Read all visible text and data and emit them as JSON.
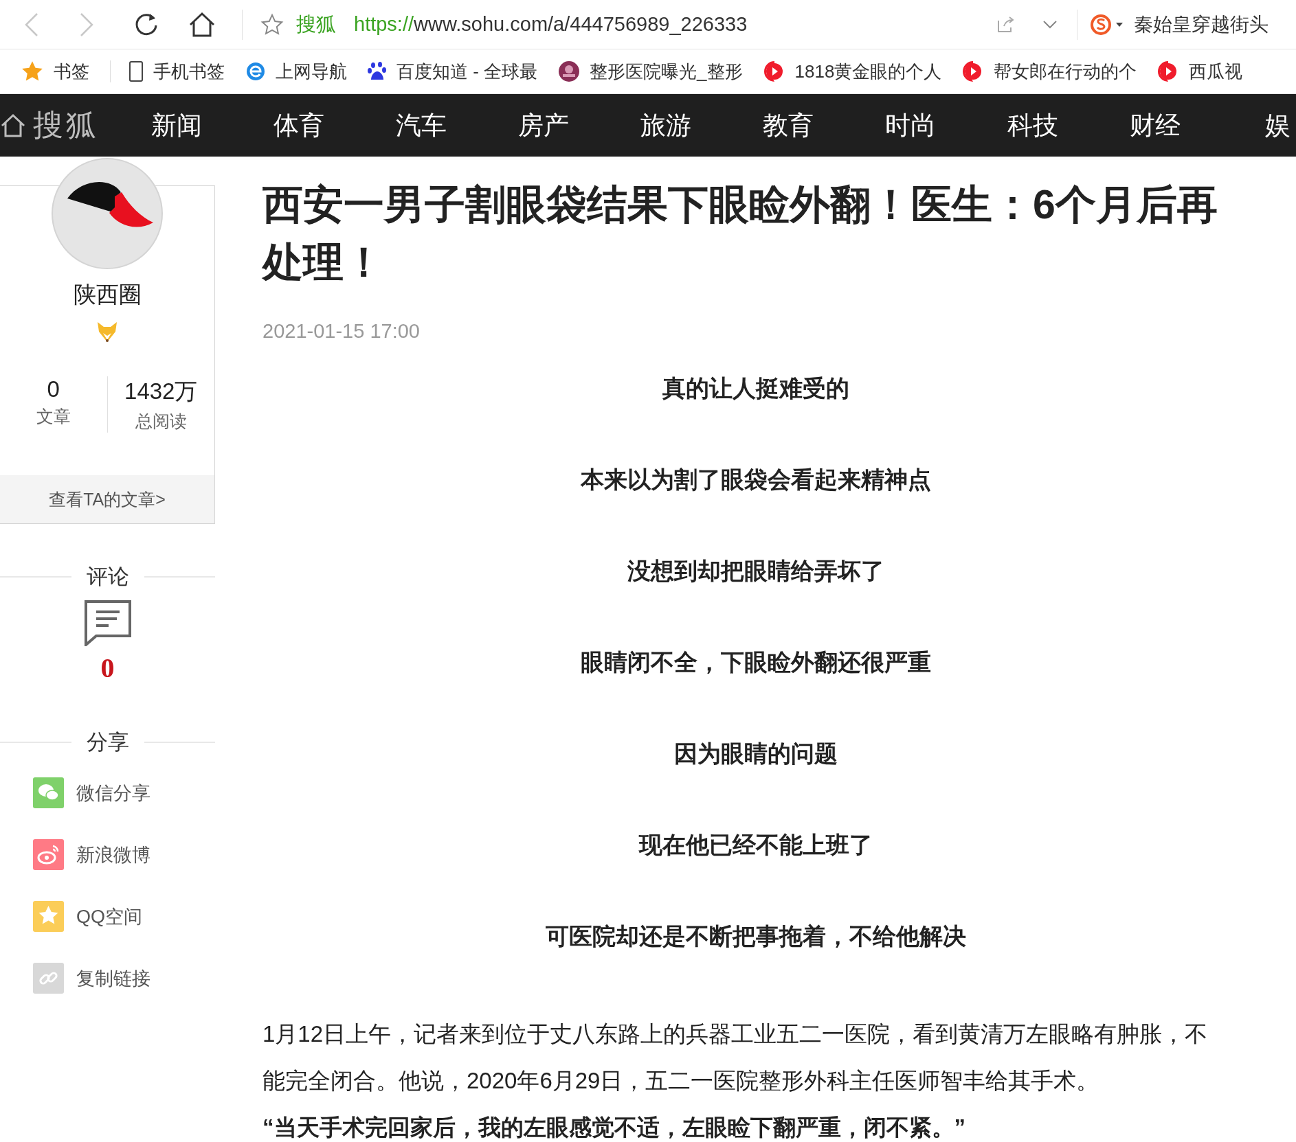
{
  "address_bar": {
    "site_name": "搜狐",
    "url_scheme": "https://",
    "url_rest": "www.sohu.com/a/444756989_226333"
  },
  "search_box": {
    "value": "秦始皇穿越街头"
  },
  "bookmarks": [
    {
      "label": "书签",
      "kind": "star"
    },
    {
      "label": "手机书签",
      "kind": "phone"
    },
    {
      "label": "上网导航",
      "kind": "browser"
    },
    {
      "label": "百度知道 - 全球最",
      "kind": "paw"
    },
    {
      "label": "整形医院曝光_整形",
      "kind": "badge"
    },
    {
      "label": "1818黄金眼的个人",
      "kind": "video"
    },
    {
      "label": "帮女郎在行动的个",
      "kind": "video"
    },
    {
      "label": "西瓜视",
      "kind": "video"
    }
  ],
  "site_nav": {
    "logo": "搜狐",
    "items": [
      "新闻",
      "体育",
      "汽车",
      "房产",
      "旅游",
      "教育",
      "时尚",
      "科技",
      "财经",
      "娱"
    ]
  },
  "author": {
    "name": "陕西圈",
    "stats": [
      {
        "value": "0",
        "label": "文章"
      },
      {
        "value": "1432万",
        "label": "总阅读"
      }
    ],
    "link": "查看TA的文章>"
  },
  "comments": {
    "title": "评论",
    "count": "0"
  },
  "share": {
    "title": "分享",
    "items": [
      {
        "label": "微信分享",
        "kind": "wechat",
        "color": "#7fd16a"
      },
      {
        "label": "新浪微博",
        "kind": "weibo",
        "color": "#ff7a85"
      },
      {
        "label": "QQ空间",
        "kind": "qzone",
        "color": "#fbcd58"
      },
      {
        "label": "复制链接",
        "kind": "link",
        "color": "#d8d8d8"
      }
    ]
  },
  "article": {
    "title": "西安一男子割眼袋结果下眼睑外翻！医生：6个月后再处理！",
    "date": "2021-01-15 17:00",
    "blocks": [
      {
        "kind": "lead",
        "text": "真的让人挺难受的"
      },
      {
        "kind": "lead",
        "text": "本来以为割了眼袋会看起来精神点"
      },
      {
        "kind": "lead",
        "text": "没想到却把眼睛给弄坏了"
      },
      {
        "kind": "lead",
        "text": "眼睛闭不全，下眼睑外翻还很严重"
      },
      {
        "kind": "lead",
        "text": "因为眼睛的问题"
      },
      {
        "kind": "lead",
        "text": "现在他已经不能上班了"
      },
      {
        "kind": "lead",
        "text": "可医院却还是不断把事拖着，不给他解决"
      },
      {
        "kind": "para",
        "text": "1月12日上午，记者来到位于丈八东路上的兵器工业五二一医院，看到黄清万左眼略有肿胀，不能完全闭合。他说，2020年6月29日，五二一医院整形外科主任医师智丰给其手术。"
      },
      {
        "kind": "quote",
        "text": "“当天手术完回家后，我的左眼感觉不适，左眼睑下翻严重，闭不紧。”"
      }
    ]
  }
}
